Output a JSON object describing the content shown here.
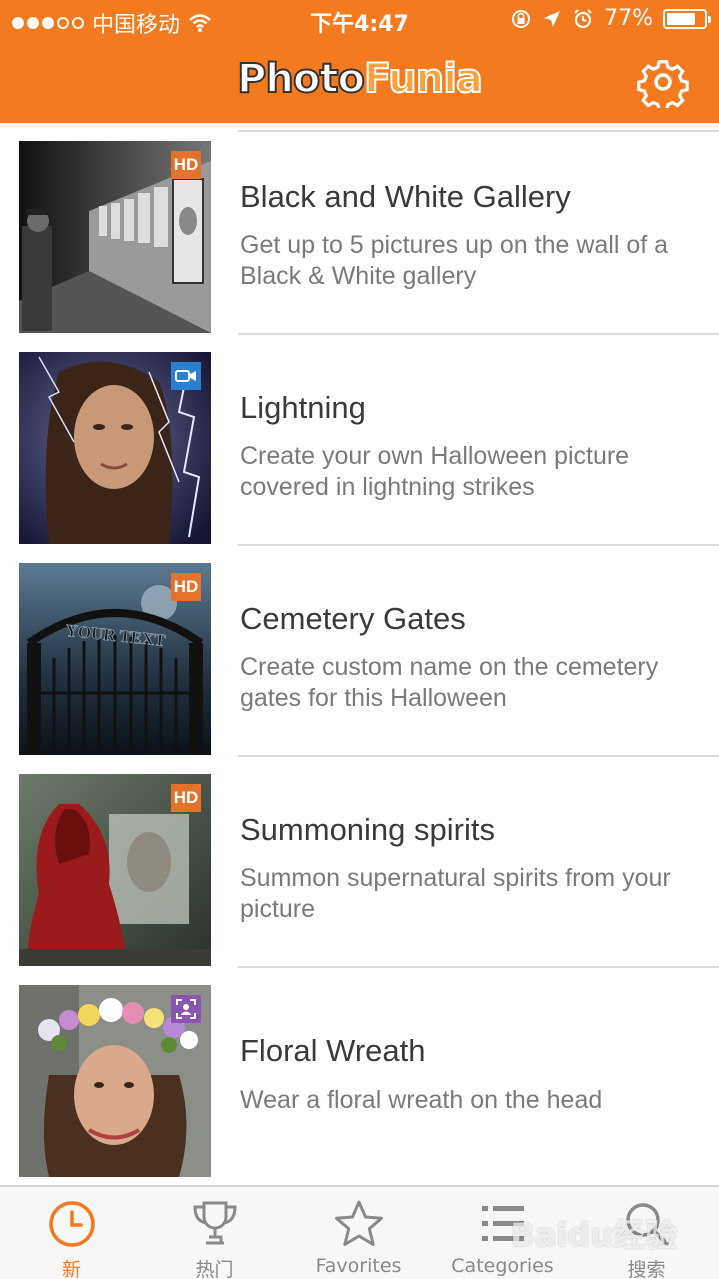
{
  "status_bar": {
    "carrier": "中国移动",
    "time": "下午4:47",
    "battery_percent": "77%",
    "battery_level": 0.77,
    "icons": [
      "signal-dots",
      "wifi-icon",
      "orientation-lock-icon",
      "location-icon",
      "alarm-icon",
      "battery-icon"
    ]
  },
  "nav": {
    "logo_part1": "Photo",
    "logo_part2": "Funia",
    "settings_icon": "gear-icon"
  },
  "colors": {
    "brand": "#f47a20",
    "hd_badge": "#e4722a",
    "video_badge": "#2b7fd0",
    "face_badge": "#8a55b0"
  },
  "effects": [
    {
      "title": "Black and White Gallery",
      "description": "Get up to 5 pictures up on the wall of a Black & White gallery",
      "badge": "HD",
      "badge_type": "hd"
    },
    {
      "title": "Lightning",
      "description": "Create your own Halloween picture covered in lightning strikes",
      "badge": "",
      "badge_type": "video"
    },
    {
      "title": "Cemetery Gates",
      "description": "Create custom name on the cemetery gates for this Halloween",
      "badge": "HD",
      "badge_type": "hd",
      "thumbnail_text": "YOUR TEXT"
    },
    {
      "title": "Summoning spirits",
      "description": "Summon supernatural spirits from your picture",
      "badge": "HD",
      "badge_type": "hd"
    },
    {
      "title": "Floral Wreath",
      "description": "Wear a floral wreath on the head",
      "badge": "",
      "badge_type": "face"
    }
  ],
  "tabs": [
    {
      "label": "新",
      "icon": "clock-icon",
      "active": true
    },
    {
      "label": "热门",
      "icon": "trophy-icon",
      "active": false
    },
    {
      "label": "Favorites",
      "icon": "star-icon",
      "active": false
    },
    {
      "label": "Categories",
      "icon": "list-icon",
      "active": false
    },
    {
      "label": "搜索",
      "icon": "search-icon",
      "active": false
    }
  ],
  "watermark": "Baidu经验"
}
